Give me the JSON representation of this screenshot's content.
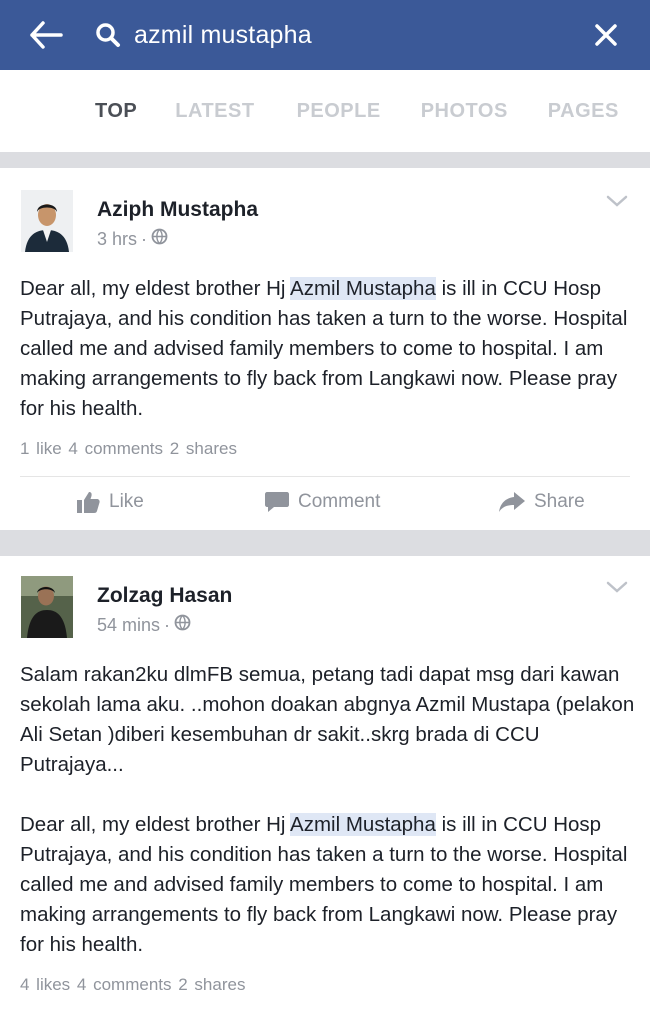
{
  "search": {
    "query": "azmil mustapha"
  },
  "icons": {
    "back": "arrow-left-icon",
    "search": "search-icon",
    "close": "close-icon",
    "globe": "globe-icon",
    "like": "thumbs-up-icon",
    "comment": "comment-bubble-icon",
    "share": "share-arrow-icon",
    "menu": "chevron-down-icon"
  },
  "colors": {
    "header": "#3b5998",
    "highlight": "#dfe7f5",
    "muted": "#90949c"
  },
  "tabs": [
    {
      "label": "TOP",
      "active": true
    },
    {
      "label": "LATEST"
    },
    {
      "label": "PEOPLE"
    },
    {
      "label": "PHOTOS"
    },
    {
      "label": "PAGES"
    }
  ],
  "posts": [
    {
      "author": "Aziph Mustapha",
      "time": "3 hrs",
      "text_before": "Dear all, my eldest brother Hj ",
      "highlight": "Azmil Mustapha",
      "text_after": " is ill in CCU Hosp Putrajaya, and his condition has taken a turn to the worse. Hospital called me and advised family members to come to hospital. I am making arrangements to fly back from Langkawi now. Please pray for his health.",
      "counts": {
        "likes": "1 like",
        "comments": "4 comments",
        "shares": "2 shares"
      },
      "actions": {
        "like": "Like",
        "comment": "Comment",
        "share": "Share"
      }
    },
    {
      "author": "Zolzag Hasan",
      "time": "54 mins",
      "intro": "Salam rakan2ku dlmFB semua, petang tadi dapat msg dari kawan sekolah lama aku. ..mohon doakan  abgnya Azmil Mustapa (pelakon Ali Setan )diberi kesembuhan dr sakit..skrg brada di CCU Putrajaya...",
      "text_before": "Dear all, my eldest brother Hj ",
      "highlight": "Azmil Mustapha",
      "text_after": " is ill in CCU Hosp Putrajaya, and his condition has taken a turn to the worse. Hospital called me and advised family members to come to hospital. I am making arrangements to fly back from Langkawi now. Please pray for his health.",
      "counts": {
        "likes": "4 likes",
        "comments": "4 comments",
        "shares": "2 shares"
      }
    }
  ]
}
